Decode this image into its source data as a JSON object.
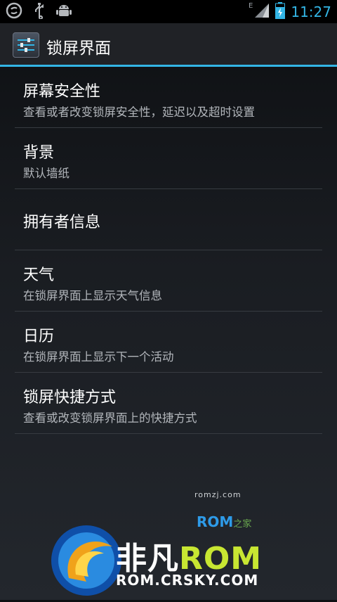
{
  "status_bar": {
    "time": "11:27",
    "network_type": "E",
    "icons": [
      "weibo-notification-icon",
      "usb-icon",
      "android-debug-icon",
      "signal-icon",
      "battery-charging-icon"
    ]
  },
  "action_bar": {
    "title": "锁屏界面",
    "icon": "settings-sliders-icon"
  },
  "settings": {
    "items": [
      {
        "title": "屏幕安全性",
        "summary": "查看或者改变锁屏安全性，延迟以及超时设置"
      },
      {
        "title": "背景",
        "summary": "默认墙纸"
      },
      {
        "title": "拥有者信息",
        "summary": ""
      },
      {
        "title": "天气",
        "summary": "在锁屏界面上显示天气信息"
      },
      {
        "title": "日历",
        "summary": "在锁屏界面上显示下一个活动"
      },
      {
        "title": "锁屏快捷方式",
        "summary": "查看或改变锁屏界面上的快捷方式"
      }
    ]
  },
  "watermark": {
    "small_text": "romzj.com",
    "romzj_label": "ROM",
    "romzj_suffix": "之家",
    "brand_cn": "非凡",
    "brand_rom": "ROM",
    "url": "ROM.CRSKY.COM"
  },
  "colors": {
    "accent": "#33b5e5",
    "title_text": "#ffffff",
    "summary_text": "#b2b6bb",
    "divider": "#373b41"
  }
}
